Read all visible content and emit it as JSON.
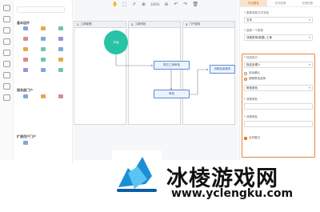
{
  "rail": {
    "items": [
      "",
      "",
      "",
      "",
      "",
      "",
      "",
      "",
      "",
      "",
      "",
      "",
      "",
      "",
      "",
      ""
    ]
  },
  "components": {
    "section1": "基本组件",
    "section1_items": [
      "",
      "",
      "",
      "",
      "",
      "",
      "",
      "",
      "",
      "",
      "",
      "",
      "",
      "",
      ""
    ],
    "section2": "服务器门户",
    "section2_items": [
      "",
      "",
      ""
    ],
    "section3": "扩展用户门户",
    "section3_items": [
      ""
    ]
  },
  "toolbar": {
    "zoom": "100%"
  },
  "lanes": [
    {
      "num": "1",
      "title": "工单管理"
    },
    {
      "num": "2",
      "title": "工单审批"
    },
    {
      "num": "3",
      "title": "门户服务"
    }
  ],
  "flow": {
    "start": "开始",
    "node1": "提交工单审批",
    "node2": "审批",
    "node3": "流程结束服务"
  },
  "props": {
    "tabs": [
      "节点属性",
      "任务配置",
      "流程配置"
    ],
    "field1_label": "* 表单流转方式字段",
    "field1_value": "文本",
    "field2_label": "* 选择一个表单",
    "field2_value": "流程表单(数据) 工单",
    "field3_label": "* 任务执行",
    "field3_value": "指定处理人",
    "radio1": "自动确认",
    "radio2": "按照角色选择",
    "field4_value": "审批角色",
    "field5_label": "* 流程审批",
    "field5_value": "",
    "field6_label": "* 流程审批",
    "field6_value": "",
    "checkbox": "允许跳过"
  },
  "watermark": {
    "title": "冰棱游戏网",
    "url": "www.yclengku.com"
  },
  "colors": {
    "accent": "#e8873a",
    "start_node": "#28c3a4",
    "task_node_border": "#5c8bd6"
  }
}
